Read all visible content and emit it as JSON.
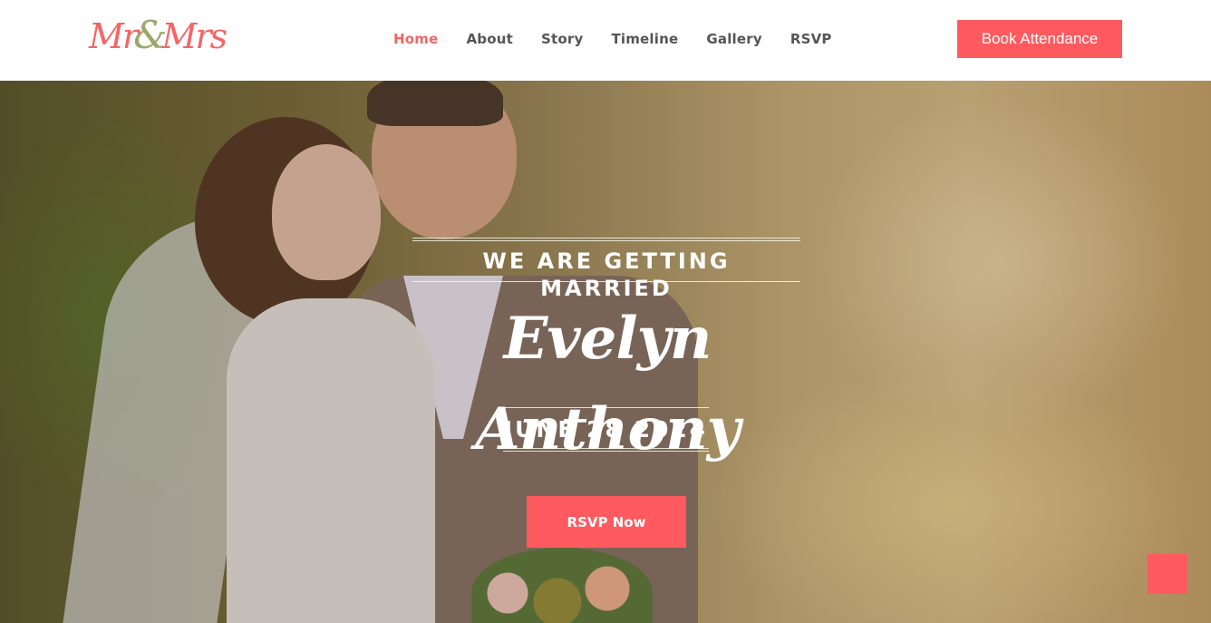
{
  "brand": {
    "logo_text_1": "Mr",
    "logo_amp": "&",
    "logo_text_2": "Mrs"
  },
  "nav": {
    "items": [
      {
        "label": "Home",
        "active": true
      },
      {
        "label": "About",
        "active": false
      },
      {
        "label": "Story",
        "active": false
      },
      {
        "label": "Timeline",
        "active": false
      },
      {
        "label": "Gallery",
        "active": false
      },
      {
        "label": "RSVP",
        "active": false
      }
    ],
    "cta_label": "Book Attendance"
  },
  "hero": {
    "subtitle": "WE ARE GETTING MARRIED",
    "names": "Evelyn Anthony",
    "date": "JUNE 28 2024",
    "rsvp_label": "RSVP Now"
  },
  "colors": {
    "accent": "#ff5a5f",
    "nav_text": "#555555",
    "logo_accent": "#9aa86a"
  },
  "icons": {
    "scroll_top": "scroll-top-icon"
  }
}
